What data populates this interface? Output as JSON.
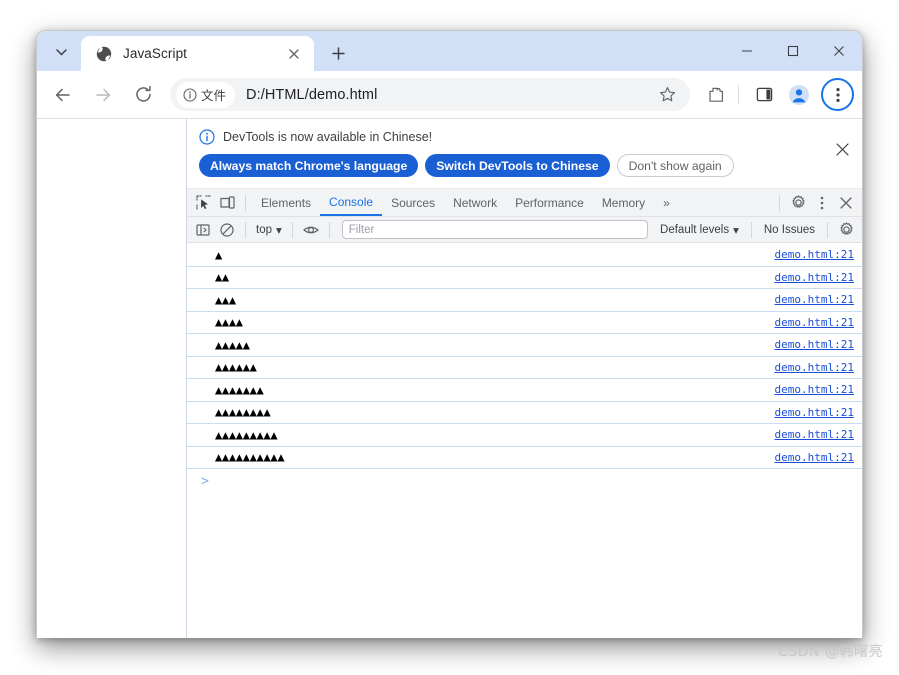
{
  "browser": {
    "tab": {
      "title": "JavaScript",
      "favicon": "globe-icon",
      "close_label": "×"
    },
    "new_tab_label": "+",
    "tab_search_label": "▾",
    "window_controls": {
      "minimize": "—",
      "maximize": "□",
      "close": "✕"
    },
    "toolbar": {
      "back": "←",
      "forward": "→",
      "reload": "↻",
      "site_chip_label": "文件",
      "url": "D:/HTML/demo.html",
      "star": "star-icon",
      "extensions": "puzzle-icon",
      "side_panel": "side-panel-icon",
      "profile": "profile-avatar-icon",
      "menu": "three-dot-menu-icon"
    }
  },
  "devtools": {
    "notification": {
      "message": "DevTools is now available in Chinese!",
      "info_icon": "info-icon",
      "buttons": [
        {
          "label": "Always match Chrome's language",
          "style": "primary"
        },
        {
          "label": "Switch DevTools to Chinese",
          "style": "primary"
        },
        {
          "label": "Don't show again",
          "style": "secondary"
        }
      ],
      "close_label": "✕"
    },
    "tabbar": {
      "inspect_icon": "inspect-element-icon",
      "device_icon": "device-toolbar-icon",
      "tabs": [
        {
          "label": "Elements",
          "active": false
        },
        {
          "label": "Console",
          "active": true
        },
        {
          "label": "Sources",
          "active": false
        },
        {
          "label": "Network",
          "active": false
        },
        {
          "label": "Performance",
          "active": false
        },
        {
          "label": "Memory",
          "active": false
        }
      ],
      "overflow_label": "»",
      "settings_icon": "gear-icon",
      "more_icon": "more-vertical-icon",
      "close_label": "✕"
    },
    "console_toolbar": {
      "sidebar_icon": "console-sidebar-icon",
      "clear_icon": "clear-console-icon",
      "context": "top",
      "context_caret": "▾",
      "eye_icon": "live-expression-icon",
      "filter_placeholder": "Filter",
      "levels_label": "Default levels",
      "levels_caret": "▾",
      "issues_label": "No Issues",
      "settings_icon": "console-settings-icon"
    },
    "console": {
      "source_link": "demo.html:21",
      "prompt_caret": ">",
      "rows": [
        {
          "message": "▲"
        },
        {
          "message": "▲▲"
        },
        {
          "message": "▲▲▲"
        },
        {
          "message": "▲▲▲▲"
        },
        {
          "message": "▲▲▲▲▲"
        },
        {
          "message": "▲▲▲▲▲▲"
        },
        {
          "message": "▲▲▲▲▲▲▲"
        },
        {
          "message": "▲▲▲▲▲▲▲▲"
        },
        {
          "message": "▲▲▲▲▲▲▲▲▲"
        },
        {
          "message": "▲▲▲▲▲▲▲▲▲▲"
        }
      ]
    }
  },
  "watermark": "CSDN @韩曙亮",
  "colors": {
    "tab_strip": "#d2e0f7",
    "accent_blue": "#1a73e8",
    "button_blue": "#1a5fd4",
    "link_blue": "#1a4fd6",
    "row_divider": "#c9ddf2"
  }
}
